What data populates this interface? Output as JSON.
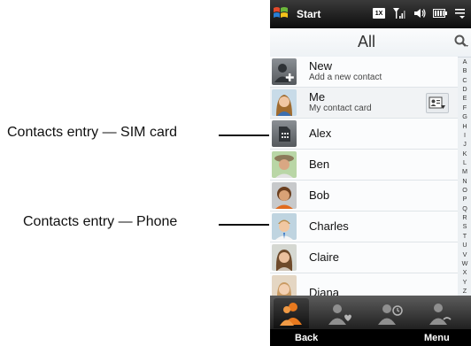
{
  "callouts": {
    "sim": "Contacts entry — SIM card",
    "phone": "Contacts entry — Phone"
  },
  "statusbar": {
    "start": "Start",
    "icons": [
      "data-1x-icon",
      "signal-icon",
      "speaker-icon",
      "battery-icon",
      "menu-dropdown-icon"
    ],
    "data_label": "1X"
  },
  "header": {
    "title": "All"
  },
  "contacts": [
    {
      "name": "New",
      "subtitle": "Add a new contact",
      "icon": "add-contact-icon"
    },
    {
      "name": "Me",
      "subtitle": "My contact card",
      "icon": "contact-photo"
    },
    {
      "name": "Alex",
      "icon": "sim-card-icon"
    },
    {
      "name": "Ben",
      "icon": "contact-photo"
    },
    {
      "name": "Bob",
      "icon": "contact-photo"
    },
    {
      "name": "Charles",
      "icon": "contact-photo"
    },
    {
      "name": "Claire",
      "icon": "contact-photo"
    },
    {
      "name": "Diana",
      "icon": "contact-photo"
    }
  ],
  "alphabet": [
    "A",
    "B",
    "C",
    "D",
    "E",
    "F",
    "G",
    "H",
    "I",
    "J",
    "K",
    "L",
    "M",
    "N",
    "O",
    "P",
    "Q",
    "R",
    "S",
    "T",
    "U",
    "V",
    "W",
    "X",
    "Y",
    "Z"
  ],
  "tabs": [
    {
      "name": "all-contacts-tab-icon",
      "active": true
    },
    {
      "name": "favorites-tab-icon",
      "active": false
    },
    {
      "name": "recent-tab-icon",
      "active": false
    },
    {
      "name": "social-tab-icon",
      "active": false
    }
  ],
  "softkeys": {
    "left": "Back",
    "right": "Menu"
  },
  "colors": {
    "accent": "#e8791e",
    "statusbar": "#1a1a1a",
    "background": "#ecf0f3"
  }
}
